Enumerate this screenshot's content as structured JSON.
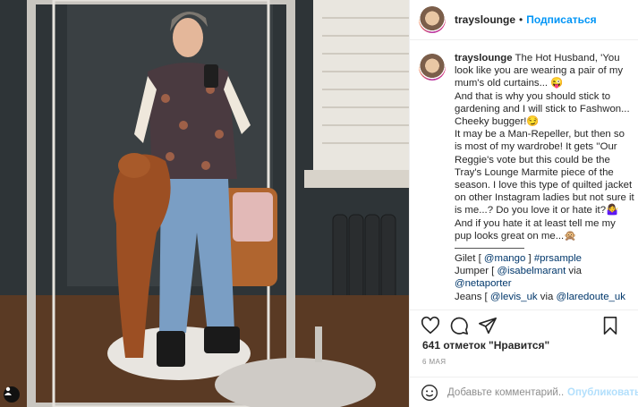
{
  "post": {
    "username": "trayslounge",
    "dot": "•",
    "follow_label": "Подписаться"
  },
  "caption": {
    "lines": [
      "The Hot Husband, 'You look like you are wearing a pair of my mum's old curtains... 😜",
      "And that is why you should stick to gardening and I will stick to Fashwon... Cheeky bugger!😏",
      "It may be a Man-Repeller, but then so is most of my wardrobe! It gets ''Our Reggie's vote but this could be the Tray's Lounge Marmite piece of the season. I love this type of quilted jacket on other Instagram ladies but not sure it is me...? Do you love it or hate it?🤷‍♀️ And if you hate it at least tell me my pup looks great on me...🙊"
    ],
    "credits": [
      {
        "label": "Gilet [ ",
        "links": [
          "@mango",
          "#prsample"
        ],
        "joiner": " ] "
      },
      {
        "label": "Jumper [ ",
        "links": [
          "@isabelmarant"
        ],
        "suffix": " via"
      },
      {
        "label": "",
        "links": [
          "@netaporter"
        ]
      },
      {
        "label": "Jeans [ ",
        "links": [
          "@levis_uk"
        ],
        "mid": " via ",
        "links2": [
          "@laredoute_uk"
        ]
      }
    ]
  },
  "actions": {
    "like": "heart-icon",
    "comment": "comment-icon",
    "share": "share-icon",
    "save": "bookmark-icon"
  },
  "likes_text": "641 отметок \"Нравится\"",
  "date_text": "6 МАЯ",
  "comment_box": {
    "placeholder": "Добавьте комментарий...",
    "publish_label": "Опубликовать"
  }
}
